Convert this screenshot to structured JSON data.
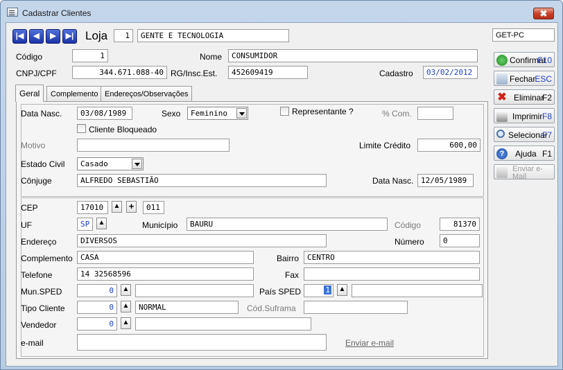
{
  "window": {
    "title": "Cadastrar Clientes",
    "close": "✖"
  },
  "header": {
    "loja_label": "Loja",
    "loja_num": "1",
    "loja_name": "GENTE E TECNOLOGIA",
    "machine": "GET-PC"
  },
  "main": {
    "codigo_label": "Código",
    "codigo": "1",
    "nome_label": "Nome",
    "nome": "CONSUMIDOR",
    "cnpj_label": "CNPJ/CPF",
    "cnpj": "344.671.088-40",
    "rg_label": "RG/Insc.Est.",
    "rg": "452609419",
    "cadastro_label": "Cadastro",
    "cadastro": "03/02/2012"
  },
  "tabs": [
    {
      "label": "Geral"
    },
    {
      "label": "Complemento"
    },
    {
      "label": "Endereços/Observações"
    }
  ],
  "geral": {
    "data_nasc_label": "Data Nasc.",
    "data_nasc": "03/08/1989",
    "sexo_label": "Sexo",
    "sexo": "Feminino",
    "representante_label": "Representante ?",
    "com_label": "% Com.",
    "com": "",
    "bloqueado_label": "Cliente Bloqueado",
    "motivo_label": "Motivo",
    "motivo": "",
    "limite_label": "Limite Crédito",
    "limite": "600,00",
    "estado_civil_label": "Estado Civil",
    "estado_civil": "Casado",
    "conjuge_label": "Cônjuge",
    "conjuge": "ALFREDO SEBASTIÃO",
    "conj_nasc_label": "Data Nasc.",
    "conj_nasc": "12/05/1989",
    "cep_label": "CEP",
    "cep1": "17010",
    "cep2": "011",
    "uf_label": "UF",
    "uf": "SP",
    "municipio_label": "Município",
    "municipio": "BAURU",
    "cod_label": "Código",
    "cod": "81370",
    "endereco_label": "Endereço",
    "endereco": "DIVERSOS",
    "numero_label": "Número",
    "numero": "0",
    "complemento_label": "Complemento",
    "complemento": "CASA",
    "bairro_label": "Bairro",
    "bairro": "CENTRO",
    "telefone_label": "Telefone",
    "telefone": "14 32568596",
    "fax_label": "Fax",
    "fax": "",
    "mun_sped_label": "Mun.SPED",
    "mun_sped": "0",
    "mun_sped_desc": "",
    "pais_sped_label": "País SPED",
    "pais_sped": "1",
    "pais_sped_desc": "",
    "tipo_cliente_label": "Tipo Cliente",
    "tipo_cliente": "0",
    "tipo_cliente_desc": "NORMAL",
    "suframa_label": "Cód.Suframa",
    "suframa": "",
    "vendedor_label": "Vendedor",
    "vendedor": "0",
    "vendedor_desc": "",
    "email_label": "e-mail",
    "email": "",
    "enviar_email_link": "Enviar e-mail"
  },
  "sidebar": [
    {
      "label": "Confirmar",
      "key": "F10",
      "icon": "confirm-icon"
    },
    {
      "label": "Fechar",
      "key": "ESC",
      "icon": "close-doc-icon"
    },
    {
      "label": "Eliminar",
      "key": "F2",
      "icon": "delete-x-icon"
    },
    {
      "label": "Imprimir",
      "key": "F8",
      "icon": "printer-icon"
    },
    {
      "label": "Selecionar",
      "key": "F7",
      "icon": "magnifier-icon"
    },
    {
      "label": "Ajuda",
      "key": "F1",
      "icon": "help-icon"
    },
    {
      "label": "Enviar e-Mail",
      "key": "",
      "icon": "send-email-icon"
    }
  ],
  "nav_buttons": [
    "first-record",
    "previous-record",
    "next-record",
    "last-record"
  ]
}
